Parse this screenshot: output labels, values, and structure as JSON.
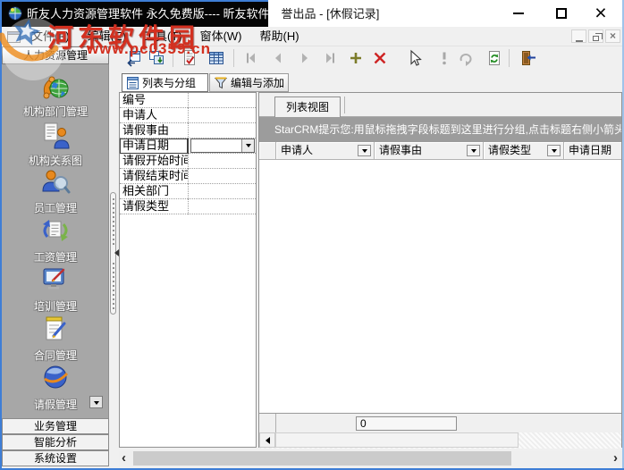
{
  "titlebar": {
    "title_part1": "昕友人力资源管理软件 永久免费版---- 昕友软件荣",
    "title_part2": "誉出品  - [休假记录]"
  },
  "menu": {
    "items": [
      {
        "label": "文件(F)"
      },
      {
        "label": "编辑(E)"
      },
      {
        "label": "工具(T)"
      },
      {
        "label": "窗体(W)"
      },
      {
        "label": "帮助(H)"
      }
    ]
  },
  "toolbar": {
    "icons": [
      "open-form",
      "save-layout",
      "edit-record",
      "grid-view",
      "first-record",
      "prev-record",
      "next-record",
      "last-record",
      "add-record",
      "delete-record",
      "pointer",
      "post-record",
      "undo",
      "refresh-data",
      "exit"
    ]
  },
  "sidebar": {
    "header": "人力资源管理",
    "items": [
      {
        "label": "机构部门管理",
        "icon": "phone-globe"
      },
      {
        "label": "机构关系图",
        "icon": "org-chart"
      },
      {
        "label": "员工管理",
        "icon": "employee-search"
      },
      {
        "label": "工资管理",
        "icon": "salary-docs"
      },
      {
        "label": "培训管理",
        "icon": "training-monitor"
      },
      {
        "label": "合同管理",
        "icon": "contract-notepad"
      },
      {
        "label": "请假管理",
        "icon": "leave-globe"
      }
    ],
    "footer_buttons": [
      {
        "label": "业务管理"
      },
      {
        "label": "智能分析"
      },
      {
        "label": "系统设置"
      }
    ]
  },
  "main": {
    "tabs": [
      {
        "label": "列表与分组"
      },
      {
        "label": "编辑与添加"
      }
    ],
    "fields": {
      "rows": [
        {
          "label": "编号"
        },
        {
          "label": "申请人"
        },
        {
          "label": "请假事由"
        },
        {
          "label": "申请日期"
        },
        {
          "label": "请假开始时间"
        },
        {
          "label": "请假结束时间"
        },
        {
          "label": "相关部门"
        },
        {
          "label": "请假类型"
        }
      ],
      "selected_field": "申请日期"
    },
    "list_view": {
      "tab_label": "列表视图",
      "tip": "StarCRM提示您:用鼠标拖拽字段标题到这里进行分组,点击标题右侧小箭头",
      "columns": [
        {
          "label": "申请人"
        },
        {
          "label": "请假事由"
        },
        {
          "label": "请假类型"
        },
        {
          "label": "申请日期"
        }
      ],
      "record_count": "0"
    }
  },
  "watermark": {
    "site_name": "河东软件园",
    "site_url": "www.pc0359.cn"
  }
}
